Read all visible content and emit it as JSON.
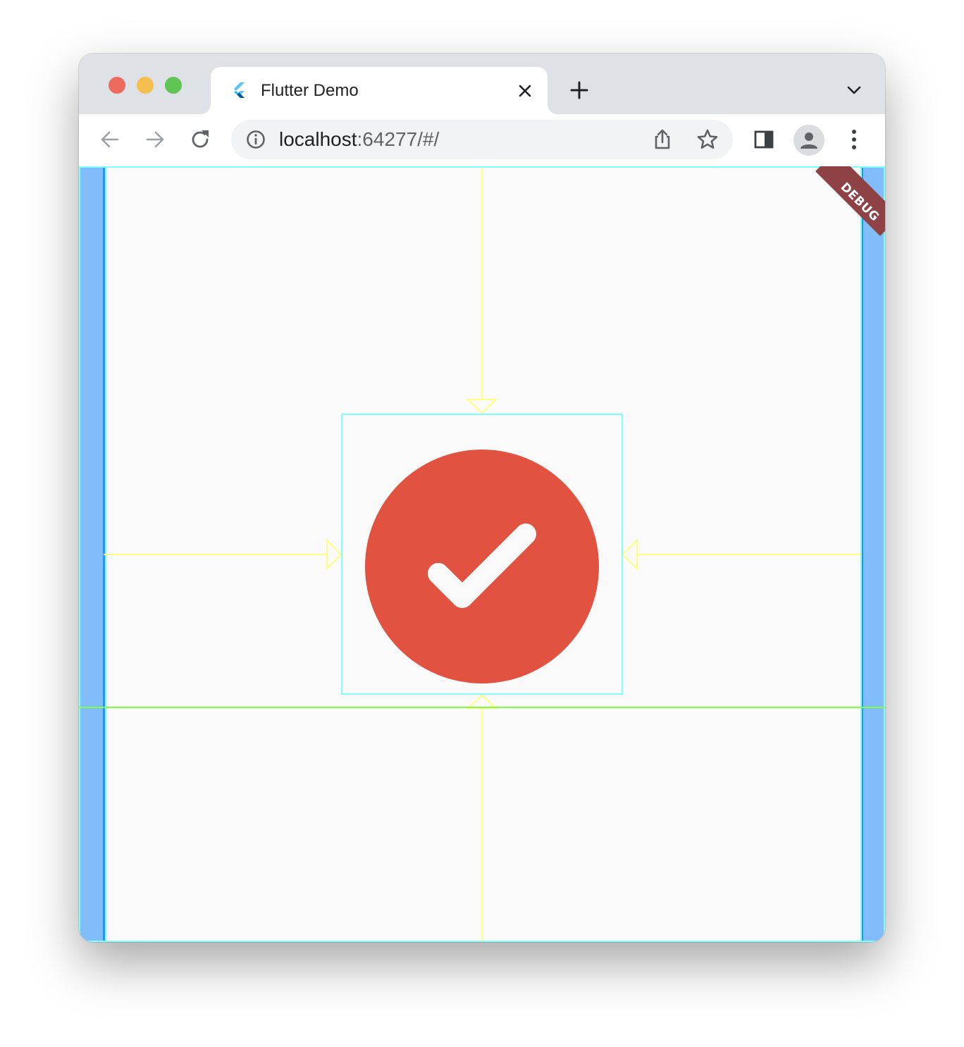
{
  "browser": {
    "tab": {
      "title": "Flutter Demo",
      "favicon": "flutter-logo-icon"
    },
    "new_tab_icon": "plus-icon",
    "tab_search_icon": "chevron-down-icon",
    "toolbar": {
      "back_icon": "arrow-left-icon",
      "forward_icon": "arrow-right-icon",
      "reload_icon": "reload-icon",
      "site_info_icon": "info-icon",
      "share_icon": "share-icon",
      "bookmark_icon": "star-icon",
      "side_panel_icon": "side-panel-icon",
      "profile_icon": "avatar-icon",
      "menu_icon": "kebab-menu-icon"
    },
    "address": {
      "host": "localhost",
      "rest": ":64277/#/"
    }
  },
  "app": {
    "debug_banner": "DEBUG",
    "center_icon": "check-circle-icon",
    "colors": {
      "background": "#fafafa",
      "icon": "#e15241",
      "debug_paint_box": "#80ffff",
      "debug_paint_arrow": "#ffff80",
      "baseline": "#80ff40",
      "padding": "#80bdfa",
      "debug_banner": "#8e4246"
    }
  }
}
